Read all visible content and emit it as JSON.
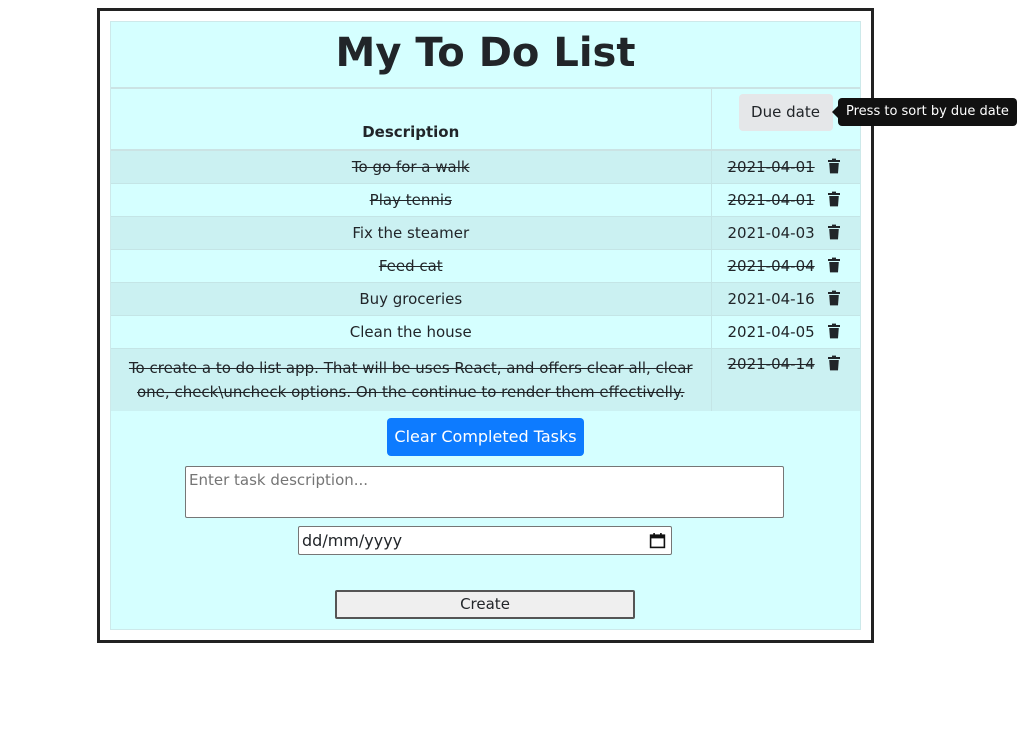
{
  "page": {
    "title": "My To Do List"
  },
  "table": {
    "headers": {
      "description": "Description",
      "due_date": "Due date"
    },
    "rows": [
      {
        "description": "To go for a walk",
        "due": "2021-04-01",
        "completed": true
      },
      {
        "description": "Play tennis",
        "due": "2021-04-01",
        "completed": true
      },
      {
        "description": "Fix the steamer",
        "due": "2021-04-03",
        "completed": false
      },
      {
        "description": "Feed cat",
        "due": "2021-04-04",
        "completed": true
      },
      {
        "description": "Buy groceries",
        "due": "2021-04-16",
        "completed": false
      },
      {
        "description": "Clean the house",
        "due": "2021-04-05",
        "completed": false
      },
      {
        "description": "To create a to do list app. That will be uses React, and offers clear all, clear one, check\\uncheck options. On the continue to render them effectivelly.",
        "due": "2021-04-14",
        "completed": true
      }
    ]
  },
  "tooltip": {
    "text": "Press to sort by due date"
  },
  "actions": {
    "clear_completed_label": "Clear Completed Tasks",
    "create_label": "Create"
  },
  "form": {
    "description_placeholder": "Enter task description...",
    "date_placeholder": "dd/mm/yyyy"
  },
  "icons": {
    "delete": "trash-icon",
    "calendar": "calendar-icon"
  },
  "colors": {
    "panel": "#d5ffff",
    "accent": "#0d7bff"
  }
}
